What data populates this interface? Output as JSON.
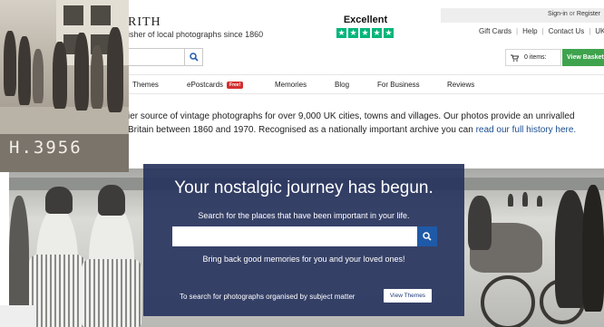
{
  "brand": {
    "name": "RITH",
    "tagline": "isher of local photographs since 1860"
  },
  "trust": {
    "label": "Excellent",
    "stars": [
      "★",
      "★",
      "★",
      "★",
      "★"
    ],
    "star_color": "#00b67a"
  },
  "account": {
    "sign_in": "Sign-in",
    "or": "or",
    "register": "Register"
  },
  "utility_links": [
    "Gift Cards",
    "Help",
    "Contact Us",
    "UK ("
  ],
  "basket": {
    "items_label": "0 items:",
    "button_label": "View Basket",
    "button_color": "#3fa34d"
  },
  "nav": [
    {
      "label": "Themes"
    },
    {
      "label": "ePostcards",
      "badge": "Free!"
    },
    {
      "label": "Memories"
    },
    {
      "label": "Blog"
    },
    {
      "label": "For Business"
    },
    {
      "label": "Reviews"
    }
  ],
  "intro": {
    "line1": "ier source of vintage photographs for over 9,000 UK cities, towns and villages. Our photos provide an unrivalled",
    "line2_prefix": "Britain between 1860 and 1970. Recognised as a nationally important archive you can ",
    "line2_link": "read our full history here."
  },
  "photo": {
    "code": "H.3956"
  },
  "hero": {
    "title": "Your nostalgic journey has begun.",
    "subtitle": "Search for the places that have been important in your life.",
    "search_value": "",
    "memories_line": "Bring back good memories for you and your loved ones!",
    "subject_text": "To search for photographs organised by subject matter",
    "view_themes_label": "View Themes",
    "overlay_color": "#28345e",
    "button_color": "#1e5aa8"
  }
}
